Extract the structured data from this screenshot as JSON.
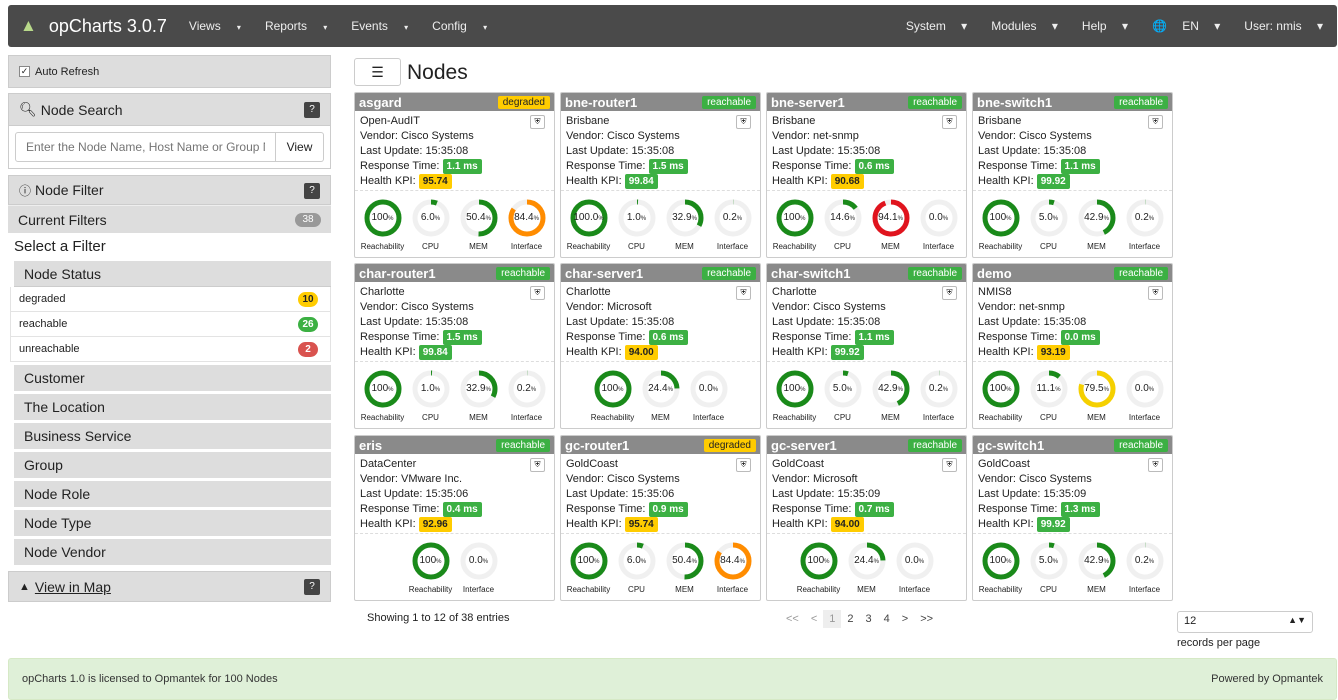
{
  "topbar": {
    "brand": "opCharts 3.0.7",
    "menus": [
      "Views",
      "Reports",
      "Events",
      "Config"
    ],
    "right_menus": [
      "System",
      "Modules",
      "Help",
      "EN",
      "User: nmis"
    ]
  },
  "sidebar": {
    "auto_refresh": "Auto Refresh",
    "node_search_title": "Node Search",
    "search_placeholder": "Enter the Node Name, Host Name or Group Na",
    "view_button": "View",
    "node_filter_title": "Node Filter",
    "current_filters": "Current Filters",
    "current_filters_count": "38",
    "select_filter": "Select a Filter",
    "node_status": "Node Status",
    "statuses": [
      {
        "label": "degraded",
        "count": "10",
        "color": "#ffcc00",
        "text": "#222"
      },
      {
        "label": "reachable",
        "count": "26",
        "color": "#3cb043",
        "text": "#fff"
      },
      {
        "label": "unreachable",
        "count": "2",
        "color": "#d9534f",
        "text": "#fff"
      }
    ],
    "categories": [
      "Customer",
      "The Location",
      "Business Service",
      "Group",
      "Node Role",
      "Node Type",
      "Node Vendor"
    ],
    "view_in_map": "View in Map",
    "help": "?"
  },
  "main": {
    "title": "Nodes"
  },
  "labels": {
    "vendor": "Vendor: ",
    "last_update": "Last Update: ",
    "response_time": "Response Time: ",
    "health_kpi": "Health KPI: "
  },
  "nodes": [
    {
      "name": "asgard",
      "status": "degraded",
      "location": "Open-AudIT",
      "vendor": "Cisco Systems",
      "updated": "15:35:08",
      "response": "1.1 ms",
      "kpi": "95.74",
      "kpi_color": "y",
      "gauges": [
        {
          "label": "Reachability",
          "value": 100,
          "text": "100",
          "color": "#1a8a1a"
        },
        {
          "label": "CPU",
          "value": 6.0,
          "text": "6.0",
          "color": "#1a8a1a"
        },
        {
          "label": "MEM",
          "value": 50.4,
          "text": "50.4",
          "color": "#1a8a1a"
        },
        {
          "label": "Interface",
          "value": 84.4,
          "text": "84.4",
          "color": "#ff8c00"
        }
      ]
    },
    {
      "name": "bne-router1",
      "status": "reachable",
      "location": "Brisbane",
      "vendor": "Cisco Systems",
      "updated": "15:35:08",
      "response": "1.5 ms",
      "kpi": "99.84",
      "kpi_color": "g",
      "gauges": [
        {
          "label": "Reachability",
          "value": 100,
          "text": "100.0",
          "color": "#1a8a1a"
        },
        {
          "label": "CPU",
          "value": 1.0,
          "text": "1.0",
          "color": "#1a8a1a"
        },
        {
          "label": "MEM",
          "value": 32.9,
          "text": "32.9",
          "color": "#1a8a1a"
        },
        {
          "label": "Interface",
          "value": 0.2,
          "text": "0.2",
          "color": "#1a8a1a"
        }
      ]
    },
    {
      "name": "bne-server1",
      "status": "reachable",
      "location": "Brisbane",
      "vendor": "net-snmp",
      "updated": "15:35:08",
      "response": "0.6 ms",
      "kpi": "90.68",
      "kpi_color": "y",
      "gauges": [
        {
          "label": "Reachability",
          "value": 100,
          "text": "100",
          "color": "#1a8a1a"
        },
        {
          "label": "CPU",
          "value": 14.6,
          "text": "14.6",
          "color": "#1a8a1a"
        },
        {
          "label": "MEM",
          "value": 94.1,
          "text": "94.1",
          "color": "#e0141e"
        },
        {
          "label": "Interface",
          "value": 0.0,
          "text": "0.0",
          "color": "#1a8a1a"
        }
      ]
    },
    {
      "name": "bne-switch1",
      "status": "reachable",
      "location": "Brisbane",
      "vendor": "Cisco Systems",
      "updated": "15:35:08",
      "response": "1.1 ms",
      "kpi": "99.92",
      "kpi_color": "g",
      "gauges": [
        {
          "label": "Reachability",
          "value": 100,
          "text": "100",
          "color": "#1a8a1a"
        },
        {
          "label": "CPU",
          "value": 5.0,
          "text": "5.0",
          "color": "#1a8a1a"
        },
        {
          "label": "MEM",
          "value": 42.9,
          "text": "42.9",
          "color": "#1a8a1a"
        },
        {
          "label": "Interface",
          "value": 0.2,
          "text": "0.2",
          "color": "#1a8a1a"
        }
      ]
    },
    {
      "name": "char-router1",
      "status": "reachable",
      "location": "Charlotte",
      "vendor": "Cisco Systems",
      "updated": "15:35:08",
      "response": "1.5 ms",
      "kpi": "99.84",
      "kpi_color": "g",
      "gauges": [
        {
          "label": "Reachability",
          "value": 100,
          "text": "100",
          "color": "#1a8a1a"
        },
        {
          "label": "CPU",
          "value": 1.0,
          "text": "1.0",
          "color": "#1a8a1a"
        },
        {
          "label": "MEM",
          "value": 32.9,
          "text": "32.9",
          "color": "#1a8a1a"
        },
        {
          "label": "Interface",
          "value": 0.2,
          "text": "0.2",
          "color": "#1a8a1a"
        }
      ]
    },
    {
      "name": "char-server1",
      "status": "reachable",
      "location": "Charlotte",
      "vendor": "Microsoft",
      "updated": "15:35:08",
      "response": "0.6 ms",
      "kpi": "94.00",
      "kpi_color": "y",
      "gauges": [
        {
          "label": "Reachability",
          "value": 100,
          "text": "100",
          "color": "#1a8a1a"
        },
        {
          "label": "MEM",
          "value": 24.4,
          "text": "24.4",
          "color": "#1a8a1a"
        },
        {
          "label": "Interface",
          "value": 0.0,
          "text": "0.0",
          "color": "#1a8a1a"
        }
      ]
    },
    {
      "name": "char-switch1",
      "status": "reachable",
      "location": "Charlotte",
      "vendor": "Cisco Systems",
      "updated": "15:35:08",
      "response": "1.1 ms",
      "kpi": "99.92",
      "kpi_color": "g",
      "gauges": [
        {
          "label": "Reachability",
          "value": 100,
          "text": "100",
          "color": "#1a8a1a"
        },
        {
          "label": "CPU",
          "value": 5.0,
          "text": "5.0",
          "color": "#1a8a1a"
        },
        {
          "label": "MEM",
          "value": 42.9,
          "text": "42.9",
          "color": "#1a8a1a"
        },
        {
          "label": "Interface",
          "value": 0.2,
          "text": "0.2",
          "color": "#1a8a1a"
        }
      ]
    },
    {
      "name": "demo",
      "status": "reachable",
      "location": "NMIS8",
      "vendor": "net-snmp",
      "updated": "15:35:08",
      "response": "0.0 ms",
      "kpi": "93.19",
      "kpi_color": "y",
      "gauges": [
        {
          "label": "Reachability",
          "value": 100,
          "text": "100",
          "color": "#1a8a1a"
        },
        {
          "label": "CPU",
          "value": 11.1,
          "text": "11.1",
          "color": "#1a8a1a"
        },
        {
          "label": "MEM",
          "value": 79.5,
          "text": "79.5",
          "color": "#f5d000"
        },
        {
          "label": "Interface",
          "value": 0.0,
          "text": "0.0",
          "color": "#1a8a1a"
        }
      ]
    },
    {
      "name": "eris",
      "status": "reachable",
      "location": "DataCenter",
      "vendor": "VMware Inc.",
      "updated": "15:35:06",
      "response": "0.4 ms",
      "kpi": "92.96",
      "kpi_color": "y",
      "gauges": [
        {
          "label": "Reachability",
          "value": 100,
          "text": "100",
          "color": "#1a8a1a"
        },
        {
          "label": "Interface",
          "value": 0.0,
          "text": "0.0",
          "color": "#1a8a1a"
        }
      ]
    },
    {
      "name": "gc-router1",
      "status": "degraded",
      "location": "GoldCoast",
      "vendor": "Cisco Systems",
      "updated": "15:35:06",
      "response": "0.9 ms",
      "kpi": "95.74",
      "kpi_color": "y",
      "gauges": [
        {
          "label": "Reachability",
          "value": 100,
          "text": "100",
          "color": "#1a8a1a"
        },
        {
          "label": "CPU",
          "value": 6.0,
          "text": "6.0",
          "color": "#1a8a1a"
        },
        {
          "label": "MEM",
          "value": 50.4,
          "text": "50.4",
          "color": "#1a8a1a"
        },
        {
          "label": "Interface",
          "value": 84.4,
          "text": "84.4",
          "color": "#ff8c00"
        }
      ]
    },
    {
      "name": "gc-server1",
      "status": "reachable",
      "location": "GoldCoast",
      "vendor": "Microsoft",
      "updated": "15:35:09",
      "response": "0.7 ms",
      "kpi": "94.00",
      "kpi_color": "y",
      "gauges": [
        {
          "label": "Reachability",
          "value": 100,
          "text": "100",
          "color": "#1a8a1a"
        },
        {
          "label": "MEM",
          "value": 24.4,
          "text": "24.4",
          "color": "#1a8a1a"
        },
        {
          "label": "Interface",
          "value": 0.0,
          "text": "0.0",
          "color": "#1a8a1a"
        }
      ]
    },
    {
      "name": "gc-switch1",
      "status": "reachable",
      "location": "GoldCoast",
      "vendor": "Cisco Systems",
      "updated": "15:35:09",
      "response": "1.3 ms",
      "kpi": "99.92",
      "kpi_color": "g",
      "gauges": [
        {
          "label": "Reachability",
          "value": 100,
          "text": "100",
          "color": "#1a8a1a"
        },
        {
          "label": "CPU",
          "value": 5.0,
          "text": "5.0",
          "color": "#1a8a1a"
        },
        {
          "label": "MEM",
          "value": 42.9,
          "text": "42.9",
          "color": "#1a8a1a"
        },
        {
          "label": "Interface",
          "value": 0.2,
          "text": "0.2",
          "color": "#1a8a1a"
        }
      ]
    }
  ],
  "pagination": {
    "info": "Showing 1 to 12 of 38 entries",
    "first": "<<",
    "prev": "<",
    "pages": [
      "1",
      "2",
      "3",
      "4"
    ],
    "current": "1",
    "next": ">",
    "last": ">>",
    "per_page_value": "12",
    "per_page_label": "records per page"
  },
  "footer": {
    "license": "opCharts 1.0 is licensed to Opmantek for 100 Nodes",
    "powered": "Powered by Opmantek"
  }
}
